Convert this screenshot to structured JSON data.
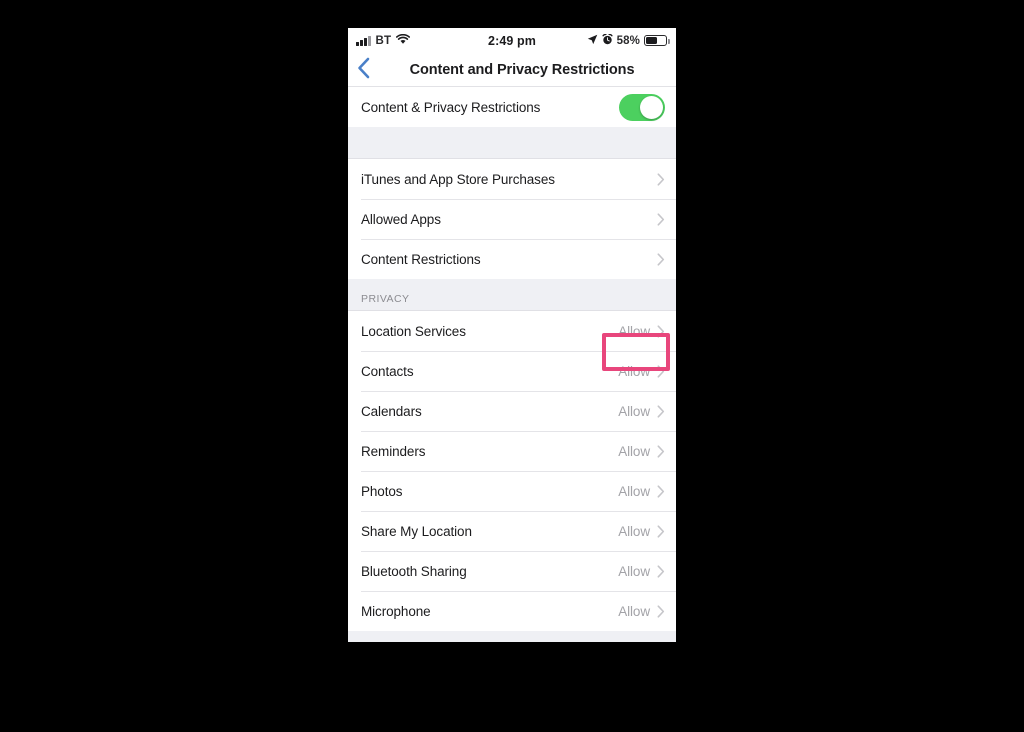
{
  "status_bar": {
    "carrier": "BT",
    "time": "2:49 pm",
    "battery_percent": "58%",
    "battery_level": 58,
    "icons": [
      "signal-bars-icon",
      "wifi-icon",
      "location-arrow-icon",
      "alarm-clock-icon",
      "battery-icon"
    ]
  },
  "nav": {
    "title": "Content and Privacy Restrictions",
    "back_label": "‹",
    "back_color": "#4a80c8"
  },
  "toggle_row": {
    "label": "Content & Privacy Restrictions",
    "state": "on",
    "on_color": "#4cd05f"
  },
  "groups": [
    {
      "header": "",
      "rows": [
        {
          "label": "iTunes and App Store Purchases",
          "value": ""
        },
        {
          "label": "Allowed Apps",
          "value": ""
        },
        {
          "label": "Content Restrictions",
          "value": ""
        }
      ]
    },
    {
      "header": "PRIVACY",
      "rows": [
        {
          "label": "Location Services",
          "value": "Allow"
        },
        {
          "label": "Contacts",
          "value": "Allow"
        },
        {
          "label": "Calendars",
          "value": "Allow"
        },
        {
          "label": "Reminders",
          "value": "Allow"
        },
        {
          "label": "Photos",
          "value": "Allow"
        },
        {
          "label": "Share My Location",
          "value": "Allow"
        },
        {
          "label": "Bluetooth Sharing",
          "value": "Allow"
        },
        {
          "label": "Microphone",
          "value": "Allow"
        }
      ]
    }
  ],
  "annotation": {
    "type": "highlight-rectangle",
    "color": "#e8467c",
    "targets_row": "Location Services",
    "targets_value": "Allow"
  },
  "colors": {
    "page_background": "#000000",
    "screen_background": "#ffffff",
    "group_gap": "#eff0f4",
    "separator": "#e4e4e8",
    "value_text": "#a3a3a8",
    "label_text": "#1c1c1e",
    "section_header_text": "#8c8c91"
  }
}
